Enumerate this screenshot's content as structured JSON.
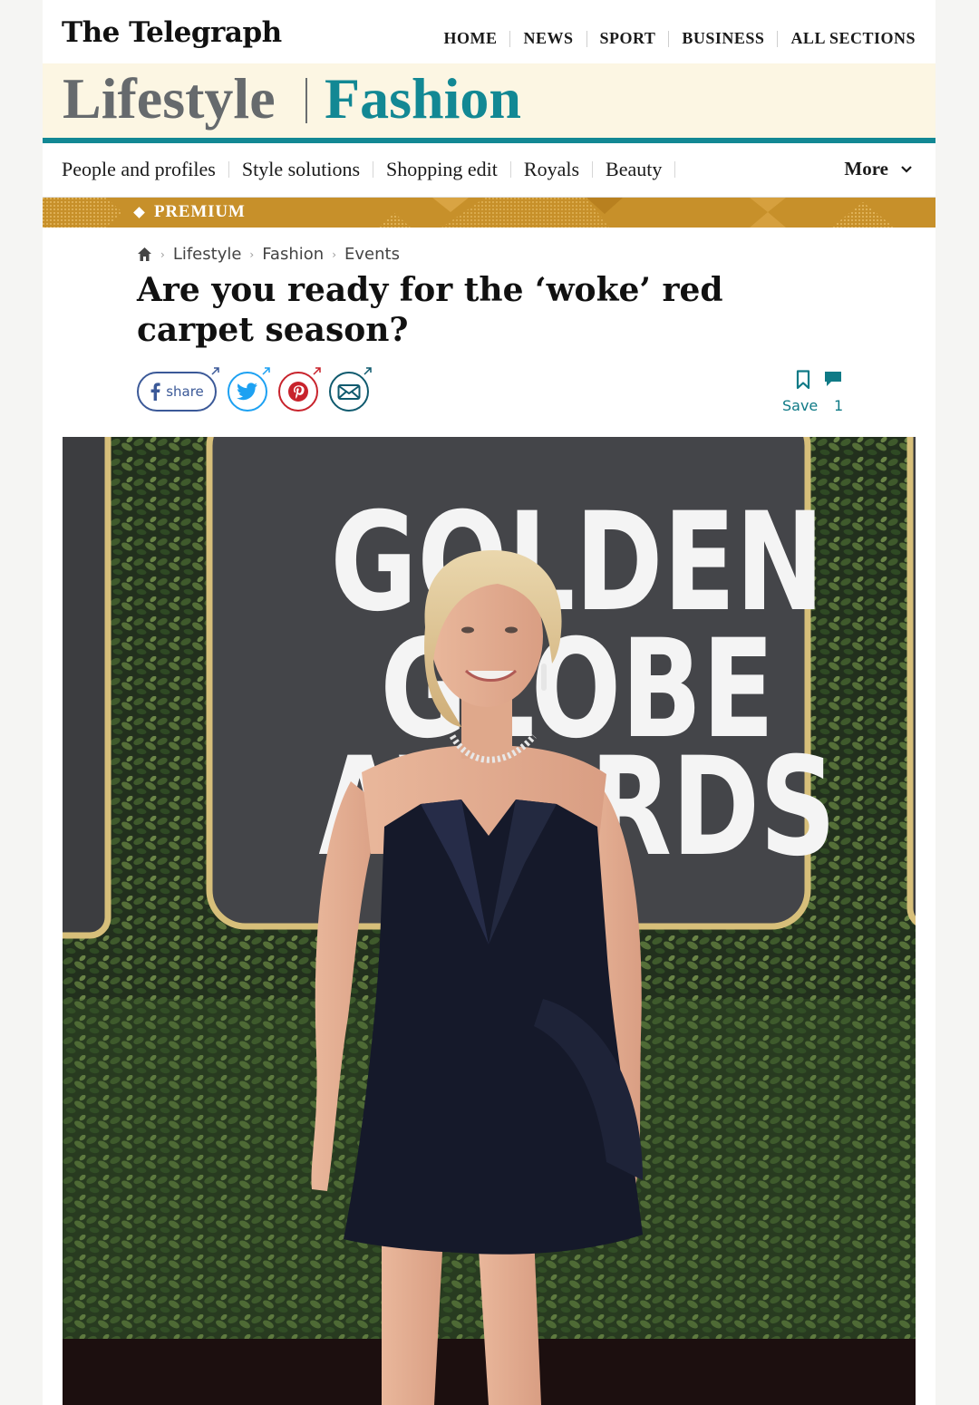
{
  "masthead": {
    "logo": "The Telegraph",
    "nav": [
      "HOME",
      "NEWS",
      "SPORT",
      "BUSINESS",
      "ALL SECTIONS"
    ]
  },
  "section": {
    "parent": "Lifestyle",
    "name": "Fashion",
    "accent_color": "#128894"
  },
  "subnav": {
    "items": [
      "People and profiles",
      "Style solutions",
      "Shopping edit",
      "Royals",
      "Beauty"
    ],
    "more_label": "More"
  },
  "premium": {
    "label": "PREMIUM",
    "color": "#c7902a"
  },
  "article": {
    "breadcrumb": [
      "Lifestyle",
      "Fashion",
      "Events"
    ],
    "headline": "Are you ready for the ‘woke’ red carpet season?",
    "share": {
      "facebook_label": "share",
      "icons": [
        "facebook-icon",
        "twitter-icon",
        "pinterest-icon",
        "email-icon"
      ]
    },
    "save_label": "Save",
    "comment_count": "1"
  },
  "photo": {
    "backdrop_text": [
      "GOLDEN",
      "GLOBE",
      "AWARDS"
    ]
  }
}
